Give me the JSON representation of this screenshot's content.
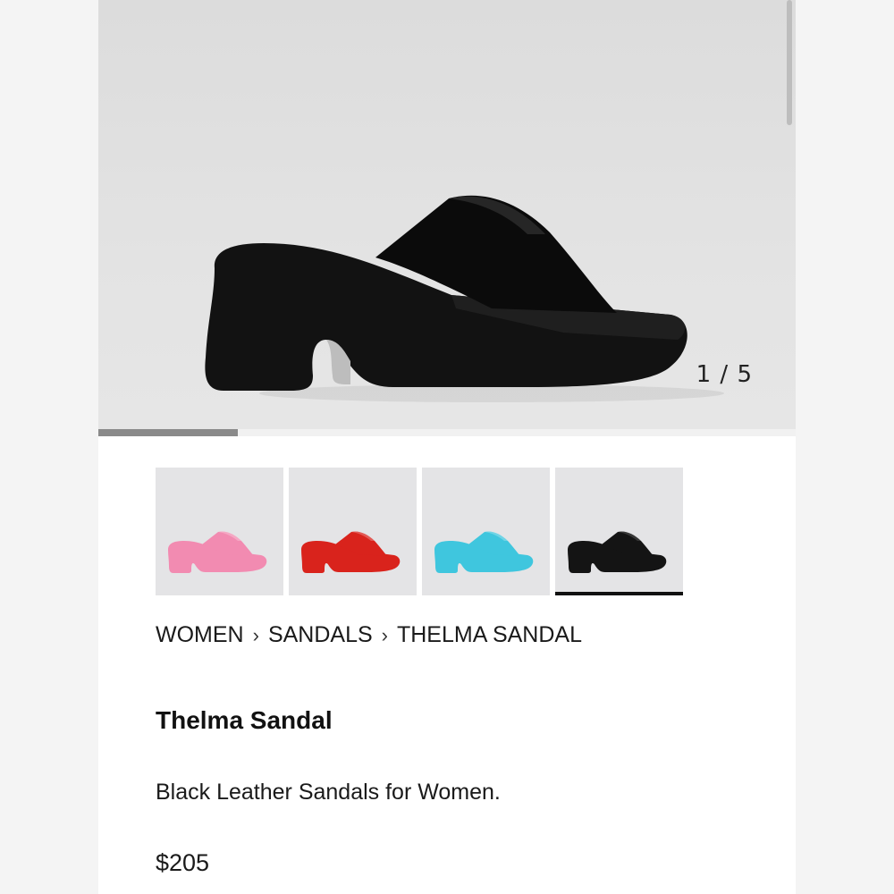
{
  "gallery": {
    "counter": "1 / 5",
    "progress": 0.2
  },
  "thumbnails": [
    {
      "color_name": "pink",
      "color": "#f28bb1",
      "selected": false
    },
    {
      "color_name": "red",
      "color": "#d9231c",
      "selected": false
    },
    {
      "color_name": "light-blue",
      "color": "#3fc6de",
      "selected": false
    },
    {
      "color_name": "black",
      "color": "#141414",
      "selected": true
    }
  ],
  "breadcrumb": {
    "items": [
      "WOMEN",
      "SANDALS",
      "THELMA SANDAL"
    ],
    "separator": "›"
  },
  "product": {
    "title": "Thelma Sandal",
    "description": "Black Leather Sandals for Women.",
    "price": "$205"
  }
}
